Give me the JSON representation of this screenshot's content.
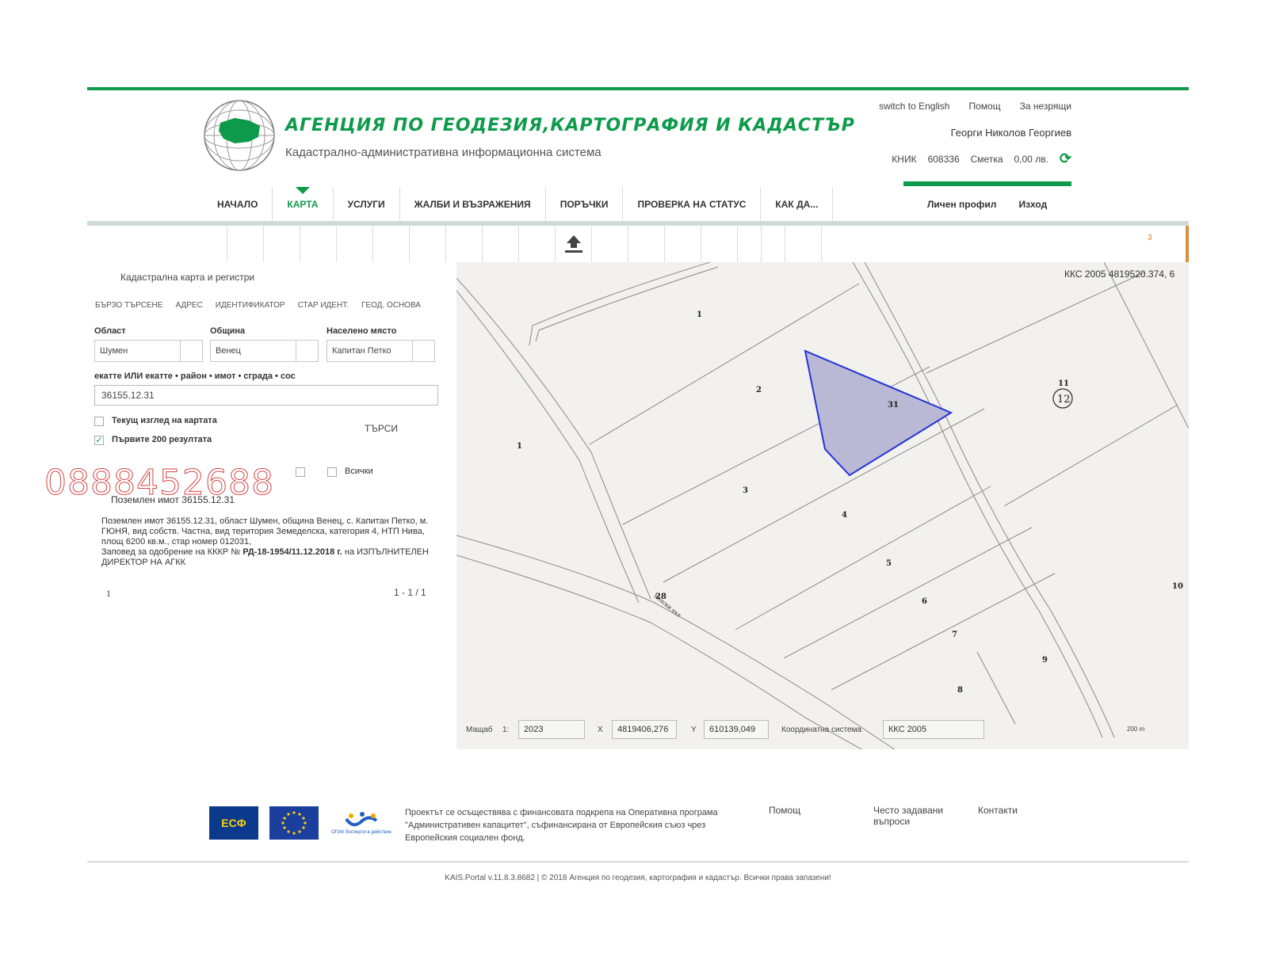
{
  "header": {
    "agency_name": "АГЕНЦИЯ ПО ГЕОДЕЗИЯ,КАРТОГРАФИЯ И КАДАСТЪР",
    "subtitle": "Кадастрално-административна информационна система",
    "links": [
      "switch to English",
      "Помощ",
      "За незрящи"
    ],
    "user_name": "Георги Николов Георгиев",
    "knik_label": "КНИК",
    "knik_value": "608336",
    "account_label": "Сметка",
    "account_value": "0,00 лв."
  },
  "nav": {
    "items": [
      "НАЧАЛО",
      "КАРТА",
      "УСЛУГИ",
      "ЖАЛБИ И ВЪЗРАЖЕНИЯ",
      "ПОРЪЧКИ",
      "ПРОВЕРКА НА СТАТУС",
      "КАК ДА..."
    ],
    "active_index": 1,
    "profile": "Личен профил",
    "logout": "Изход"
  },
  "toolbar": {
    "count": "3"
  },
  "search_panel": {
    "title": "Кадастрална карта и регистри",
    "tabs": [
      "БЪРЗО ТЪРСЕНЕ",
      "АДРЕС",
      "ИДЕНТИФИКАТОР",
      "СТАР ИДЕНТ.",
      "ГЕОД. ОСНОВА"
    ],
    "region_label": "Област",
    "region_value": "Шумен",
    "municipality_label": "Община",
    "municipality_value": "Венец",
    "settlement_label": "Населено място",
    "settlement_value": "Капитан Петко",
    "query_label": "екатте ИЛИ екатте • район • имот • сграда • сос",
    "query_value": "36155.12.31",
    "current_view_label": "Текущ изглед на картата",
    "current_view_checked": false,
    "first200_label": "Първите 200 резултата",
    "first200_checked": true,
    "search_button": "ТЪРСИ",
    "all_label": "Всички",
    "watermark": "0888452688"
  },
  "result": {
    "title": "Поземлен имот 36155.12.31",
    "desc_line1": "Поземлен имот 36155.12.31, област Шумен, община Венец, с. Капитан Петко, м. ГЮНЯ, вид собств. Частна, вид територия Земеделска, категория 4, НТП Нива, площ 6200 кв.м., стар номер 012031,",
    "desc_line2_prefix": "Заповед за одобрение на КККР №",
    "desc_order": "РД-18-1954/11.12.2018 г.",
    "desc_line2_suffix": "на ИЗПЪЛНИТЕЛЕН ДИРЕКТОР НА АГКК",
    "page": "1",
    "count": "1 - 1 / 1"
  },
  "map": {
    "coord_top": "ККС 2005 4819520.374, 6",
    "parcel_labels": {
      "p1a": "1",
      "p1b": "1",
      "p2": "2",
      "p3": "3",
      "p4": "4",
      "p5": "5",
      "p6": "6",
      "p7": "7",
      "p8": "8",
      "p9": "9",
      "p10": "10",
      "p11": "11",
      "p12": "12",
      "p31": "31",
      "p28": "28"
    },
    "road_label": "полски път",
    "scale_label": "Мащаб",
    "scale_prefix": "1:",
    "scale_value": "2023",
    "x_label": "X",
    "x_value": "4819406,276",
    "y_label": "Y",
    "y_value": "610139,049",
    "crs_label": "Координатна система",
    "crs_value": "ККС 2005",
    "scalebar": "200 m",
    "highlight_color": "#2434d6",
    "highlight_fill": "#b9b9d6"
  },
  "footer": {
    "esf_text": "ЕСФ",
    "opak_text": "ОПАК Експерти в действие",
    "funding_text": "Проектът се осъществява с финансовата подкрепа на Оперативна програма \"Административен капацитет\", съфинансирана от Европейския съюз чрез Европейския социален фонд.",
    "links": [
      "Помощ",
      "Често задавани въпроси",
      "Контакти"
    ],
    "copyright": "KAIS.Portal v.11.8.3.8682 | © 2018 Агенция по геодезия, картография и кадастър. Всички права запазени!"
  }
}
